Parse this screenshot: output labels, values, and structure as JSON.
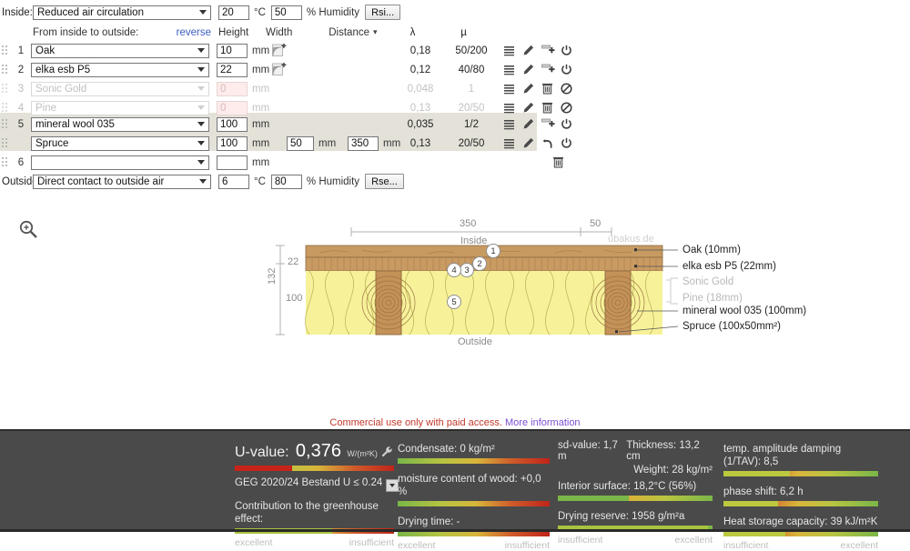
{
  "editor": {
    "inside_label": "Inside:",
    "inside_select": "Reduced air circulation",
    "inside_temp": "20",
    "temp_unit": "°C",
    "inside_humidity": "50",
    "humidity_unit": "% Humidity",
    "rsi_button": "Rsi...",
    "headers": {
      "direction": "From inside to outside:",
      "reverse": "reverse",
      "height": "Height",
      "width": "Width",
      "distance": "Distance",
      "sort_mark": "▾",
      "lambda": "λ",
      "mu": "µ"
    },
    "unit_mm": "mm",
    "rows": [
      {
        "num": "1",
        "material": "Oak",
        "height": "10",
        "width": "",
        "distance": "",
        "lambda": "0,18",
        "mu": "50/200",
        "disabled": false,
        "wood_icon": true,
        "icons": [
          "list-icon",
          "pencil-icon",
          "add-layer-icon",
          "power-icon"
        ]
      },
      {
        "num": "2",
        "material": "elka esb P5",
        "height": "22",
        "width": "",
        "distance": "",
        "lambda": "0,12",
        "mu": "40/80",
        "disabled": false,
        "wood_icon": true,
        "icons": [
          "list-icon",
          "pencil-icon",
          "add-layer-icon",
          "power-icon"
        ]
      },
      {
        "num": "3",
        "material": "Sonic Gold",
        "height": "0",
        "width": "",
        "distance": "",
        "lambda": "0,048",
        "mu": "1",
        "disabled": true,
        "wood_icon": false,
        "icons": [
          "list-icon",
          "pencil-icon",
          "trash-icon",
          "ban-icon"
        ]
      },
      {
        "num": "4",
        "material": "Pine",
        "height": "0",
        "width": "",
        "distance": "",
        "lambda": "0,13",
        "mu": "20/50",
        "disabled": true,
        "wood_icon": false,
        "icons": [
          "list-icon",
          "pencil-icon",
          "trash-icon",
          "ban-icon"
        ]
      },
      {
        "num": "5",
        "material": "mineral wool 035",
        "height": "100",
        "width": "",
        "distance": "",
        "lambda": "0,035",
        "mu": "1/2",
        "disabled": false,
        "wood_icon": false,
        "icons": [
          "list-icon",
          "pencil-icon",
          "add-layer-icon",
          "power-icon"
        ]
      },
      {
        "num": "",
        "material": "Spruce",
        "height": "100",
        "width": "50",
        "distance": "350",
        "lambda": "0,13",
        "mu": "20/50",
        "disabled": false,
        "wood_icon": false,
        "icons": [
          "list-icon",
          "pencil-icon",
          "undo-icon",
          "power-icon"
        ]
      },
      {
        "num": "6",
        "material": "",
        "height": "",
        "width": "",
        "distance": "",
        "lambda": "",
        "mu": "",
        "disabled": false,
        "wood_icon": false,
        "icons": [
          "trash-icon"
        ]
      }
    ],
    "outside_label": "Outside",
    "outside_select": "Direct contact to outside air",
    "outside_temp": "6",
    "outside_humidity": "80",
    "rse_button": "Rse..."
  },
  "diagram": {
    "zoom_icon": "zoom-in-icon",
    "watermark": "ubakus.de",
    "top_dim_main": "350",
    "top_dim_side": "50",
    "inside_label": "Inside",
    "outside_label": "Outside",
    "left_total": "132",
    "left_top": "22",
    "left_bottom": "100",
    "bubbles": [
      "1",
      "2",
      "3",
      "4",
      "5"
    ],
    "legend": [
      {
        "text": "Oak (10mm)",
        "muted": false
      },
      {
        "text": "elka esb P5 (22mm)",
        "muted": false
      },
      {
        "text": "Sonic Gold",
        "muted": true
      },
      {
        "text": "Pine (18mm)",
        "muted": true
      },
      {
        "text": "mineral wool 035 (100mm)",
        "muted": false
      },
      {
        "text": "Spruce (100x50mm²)",
        "muted": false
      }
    ]
  },
  "notice": {
    "text": "Commercial use only with paid access.",
    "link": "More information"
  },
  "results": {
    "uvalue": {
      "label": "U-value:",
      "value": "0,376",
      "unit": "W/(m²K)",
      "wrench_icon": "wrench-icon",
      "fill_pct": 36,
      "standard": "GEG 2020/24 Bestand U ≤ 0.24",
      "dropdown_icon": "chevron-down-icon"
    },
    "greenhouse": {
      "label": "Contribution to the greenhouse effect:",
      "fill_pct": 61
    },
    "scale_left": "excellent",
    "scale_right": "insufficient",
    "scale_left_alt": "insufficient",
    "scale_right_alt": "excellent",
    "metrics_col2": [
      {
        "label": "Condensate: 0 kg/m²",
        "fill_pct": 2
      },
      {
        "label": "moisture content of wood: +0,0 %",
        "fill_pct": 2
      },
      {
        "label": "Drying time: -",
        "fill_pct": 2
      }
    ],
    "col3": {
      "sd_value": "sd-value: 1,7 m",
      "thickness": "Thickness: 13,2 cm",
      "weight": "Weight: 28 kg/m²",
      "interior_surface": {
        "label": "Interior surface: 18,2°C (56%)",
        "fill_pct": 46
      },
      "drying_reserve": {
        "label": "Drying reserve: 1958 g/m²a",
        "fill_pct": 97
      }
    },
    "col4": [
      {
        "label": "temp. amplitude damping (1/TAV): 8,5",
        "fill_pct": 43
      },
      {
        "label": "phase shift: 6,2 h",
        "fill_pct": 35
      },
      {
        "label": "Heat storage capacity: 39 kJ/m²K",
        "fill_pct": 40
      }
    ]
  }
}
